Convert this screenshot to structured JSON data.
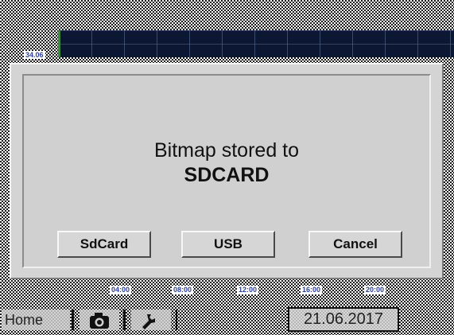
{
  "chart": {
    "y_tick": "34.06",
    "x_ticks": [
      "04:00",
      "08:00",
      "12:00",
      "16:00",
      "20:00"
    ],
    "series_color": "#1ea21e"
  },
  "dialog": {
    "message_line1": "Bitmap stored to",
    "message_line2": "SDCARD",
    "buttons": {
      "sdcard": "SdCard",
      "usb": "USB",
      "cancel": "Cancel"
    }
  },
  "statusbar": {
    "home_label": "Home",
    "camera_icon": "camera-icon",
    "tools_icon": "wrench-icon",
    "date": "21.06.2017"
  }
}
